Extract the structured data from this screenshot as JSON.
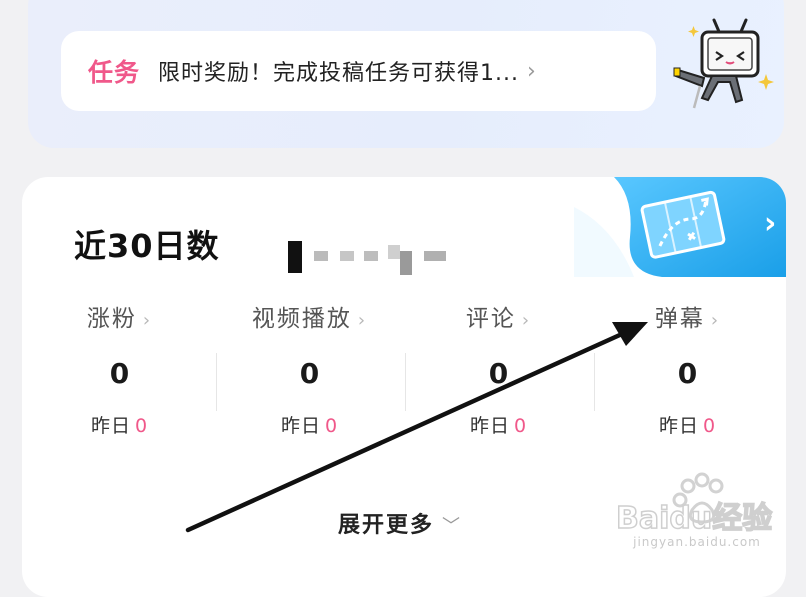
{
  "task": {
    "tag": "任务",
    "text": "限时奖励！完成投稿任务可获得1...",
    "chevron": "›",
    "mascot_icon": "tv-mascot-icon"
  },
  "data_section": {
    "title": "近30日数",
    "banner_icon": "map-arrow-icon",
    "banner_chevron": "›",
    "columns": [
      {
        "label": "涨粉",
        "chevron": "›",
        "value": "0",
        "yesterday_label": "昨日",
        "yesterday_value": "0"
      },
      {
        "label": "视频播放",
        "chevron": "›",
        "value": "0",
        "yesterday_label": "昨日",
        "yesterday_value": "0"
      },
      {
        "label": "评论",
        "chevron": "›",
        "value": "0",
        "yesterday_label": "昨日",
        "yesterday_value": "0"
      },
      {
        "label": "弹幕",
        "chevron": "›",
        "value": "0",
        "yesterday_label": "昨日",
        "yesterday_value": "0"
      }
    ],
    "expand_label": "展开更多",
    "expand_chevron": "﹀"
  },
  "watermark": {
    "brand": "Baidu经验",
    "url": "jingyan.baidu.com"
  },
  "colors": {
    "accent_pink": "#f0588a",
    "banner_blue": "#1ea6f0"
  }
}
